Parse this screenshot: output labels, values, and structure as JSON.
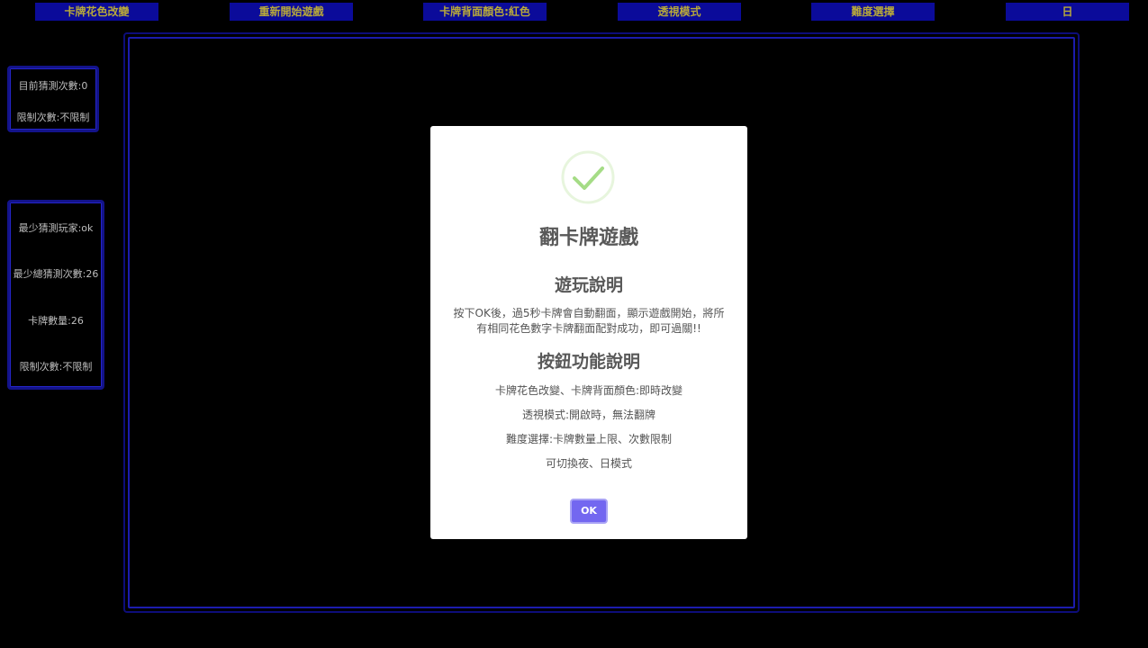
{
  "toolbar": {
    "suit_change": "卡牌花色改變",
    "restart": "重新開始遊戲",
    "back_color": "卡牌背面顏色:紅色",
    "peek_mode": "透視模式",
    "difficulty": "難度選擇",
    "day_night": "日"
  },
  "status_panel": {
    "guess_count": "目前猜測次數:0",
    "limit": "限制次數:不限制"
  },
  "record_panel": {
    "best_player": "最少猜測玩家:ok",
    "best_total": "最少總猜測次數:26",
    "card_count": "卡牌數量:26",
    "limit": "限制次數:不限制"
  },
  "dialog": {
    "icon": "check-icon",
    "title": "翻卡牌遊戲",
    "howto_title": "遊玩說明",
    "howto_text": "按下OK後，過5秒卡牌會自動翻面，顯示遊戲開始，將所有相同花色數字卡牌翻面配對成功，即可過關!!",
    "buttons_title": "按鈕功能說明",
    "lines": [
      "卡牌花色改變、卡牌背面顏色:即時改變",
      "透視模式:開啟時，無法翻牌",
      "難度選擇:卡牌數量上限、次數限制",
      "可切換夜、日模式"
    ],
    "ok_label": "OK"
  },
  "colors": {
    "background": "#000000",
    "toolbar_button": "#0b0b9a",
    "toolbar_text": "#b8a93a",
    "panel_border": "#13138a",
    "ok_button": "#7367f0",
    "check_green": "#a5dc86"
  }
}
